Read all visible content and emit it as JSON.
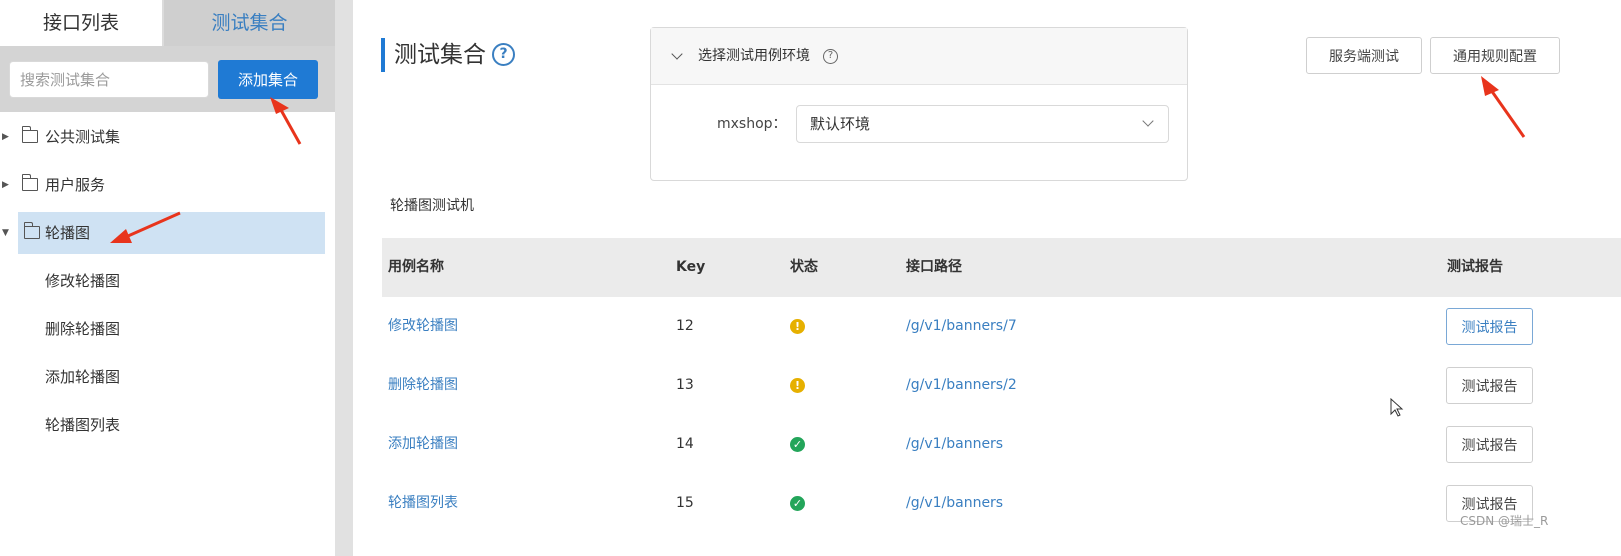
{
  "sidebar": {
    "tabs": [
      "接口列表",
      "测试集合"
    ],
    "search_placeholder": "搜索测试集合",
    "add_button": "添加集合",
    "tree": {
      "collapsed_nodes": [
        "公共测试集",
        "用户服务"
      ],
      "expanded_node": "轮播图",
      "children": [
        "修改轮播图",
        "删除轮播图",
        "添加轮播图",
        "轮播图列表"
      ]
    }
  },
  "header": {
    "title": "测试集合",
    "help_glyph": "?",
    "buttons": {
      "server_test": "服务端测试",
      "general_rules": "通用规则配置"
    }
  },
  "env_panel": {
    "title": "选择测试用例环境",
    "label": "mxshop：",
    "selected_env": "默认环境"
  },
  "section_label": "轮播图测试机",
  "table": {
    "columns": [
      "用例名称",
      "Key",
      "状态",
      "接口路径",
      "测试报告"
    ],
    "rows": [
      {
        "name": "修改轮播图",
        "key": "12",
        "status": "warning",
        "path": "/g/v1/banners/7",
        "report": "测试报告"
      },
      {
        "name": "删除轮播图",
        "key": "13",
        "status": "warning",
        "path": "/g/v1/banners/2",
        "report": "测试报告"
      },
      {
        "name": "添加轮播图",
        "key": "14",
        "status": "success",
        "path": "/g/v1/banners",
        "report": "测试报告"
      },
      {
        "name": "轮播图列表",
        "key": "15",
        "status": "success",
        "path": "/g/v1/banners",
        "report": "测试报告"
      }
    ]
  },
  "colors": {
    "primary": "#1f7ad4",
    "link": "#3a7fc1",
    "warning": "#e6b000",
    "success": "#23a55a",
    "annotation_arrow": "#e8341c",
    "selected_bg": "#cfe2f3"
  },
  "watermark": "CSDN @瑞士_R"
}
